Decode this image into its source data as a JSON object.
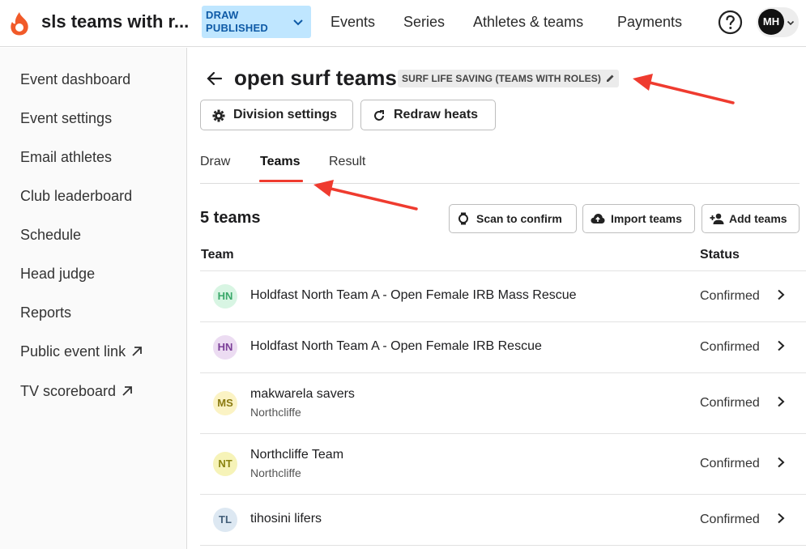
{
  "header": {
    "app_title": "sls teams with r...",
    "draw_status": [
      "DRAW",
      "PUBLISHED"
    ],
    "nav": [
      {
        "label": "Events"
      },
      {
        "label": "Series"
      },
      {
        "label": "Athletes & teams"
      },
      {
        "label": "Payments"
      }
    ],
    "help_icon": "question-circle-icon",
    "user_initials": "MH"
  },
  "sidebar": {
    "items": [
      {
        "label": "Event dashboard"
      },
      {
        "label": "Event settings"
      },
      {
        "label": "Email athletes"
      },
      {
        "label": "Club leaderboard"
      },
      {
        "label": "Schedule"
      },
      {
        "label": "Head judge"
      },
      {
        "label": "Reports"
      },
      {
        "label": "Public event link",
        "icon": "external-link-icon"
      },
      {
        "label": "TV scoreboard",
        "icon": "external-link-icon"
      }
    ]
  },
  "page": {
    "title": "open surf teams",
    "event_type": "SURF LIFE SAVING (TEAMS WITH ROLES)",
    "buttons": {
      "division_settings": "Division settings",
      "redraw_heats": "Redraw heats"
    },
    "tabs": [
      {
        "label": "Draw",
        "active": false
      },
      {
        "label": "Teams",
        "active": true
      },
      {
        "label": "Result",
        "active": false
      }
    ]
  },
  "teams": {
    "count_label": "5 teams",
    "actions": {
      "scan": "Scan to confirm",
      "import": "Import teams",
      "add": "Add teams"
    },
    "columns": {
      "team": "Team",
      "status": "Status"
    },
    "rows": [
      {
        "initials": "HN",
        "name": "Holdfast North Team A - Open Female IRB Mass Rescue",
        "club": "",
        "status": "Confirmed",
        "avatar_bg": "#d8f5e3",
        "avatar_fg": "#3aa86a"
      },
      {
        "initials": "HN",
        "name": "Holdfast North Team A - Open Female IRB Rescue",
        "club": "",
        "status": "Confirmed",
        "avatar_bg": "#ecdcf2",
        "avatar_fg": "#7b3f98"
      },
      {
        "initials": "MS",
        "name": "makwarela savers",
        "club": "Northcliffe",
        "status": "Confirmed",
        "avatar_bg": "#fbf3c4",
        "avatar_fg": "#8a7a10"
      },
      {
        "initials": "NT",
        "name": "Northcliffe Team",
        "club": "Northcliffe",
        "status": "Confirmed",
        "avatar_bg": "#f6f3b8",
        "avatar_fg": "#8a8410"
      },
      {
        "initials": "TL",
        "name": "tihosini lifers",
        "club": "",
        "status": "Confirmed",
        "avatar_bg": "#dde8f2",
        "avatar_fg": "#45607a"
      }
    ]
  },
  "colors": {
    "accent_red": "#ef3b2f",
    "badge_bg": "#bfe6ff",
    "badge_text": "#0e5aa6"
  }
}
